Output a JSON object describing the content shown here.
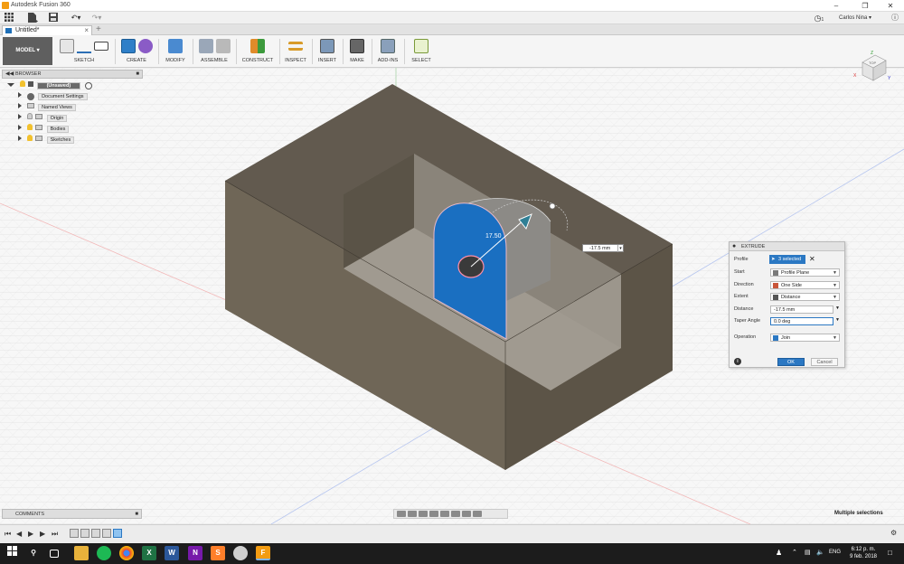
{
  "window": {
    "title": "Autodesk Fusion 360",
    "minimize_glyph": "–",
    "restore_glyph": "❐",
    "close_glyph": "✕"
  },
  "quick_access": {
    "user_name": "Carlos Nina",
    "jobs_count": "1"
  },
  "tabs": [
    {
      "label": "Untitled*"
    }
  ],
  "workspace": {
    "label": "MODEL"
  },
  "toolbar": {
    "groups": [
      {
        "label": "SKETCH"
      },
      {
        "label": "CREATE"
      },
      {
        "label": "MODIFY"
      },
      {
        "label": "ASSEMBLE"
      },
      {
        "label": "CONSTRUCT"
      },
      {
        "label": "INSPECT"
      },
      {
        "label": "INSERT"
      },
      {
        "label": "MAKE"
      },
      {
        "label": "ADD-INS"
      },
      {
        "label": "SELECT"
      }
    ],
    "active_group": "CREATE"
  },
  "browser": {
    "title": "BROWSER",
    "root": "(Unsaved)",
    "items": [
      {
        "label": "Document Settings"
      },
      {
        "label": "Named Views"
      },
      {
        "label": "Origin"
      },
      {
        "label": "Bodies"
      },
      {
        "label": "Sketches"
      }
    ]
  },
  "viewport": {
    "manipulator_label": "17.50",
    "distance_input": "-17.5 mm",
    "viewcube_face": "TOP",
    "viewcube_axes": [
      "X",
      "Y",
      "Z"
    ]
  },
  "extrude_dialog": {
    "title": "EXTRUDE",
    "rows": [
      {
        "label": "Profile",
        "value": "3 selected"
      },
      {
        "label": "Start",
        "value": "Profile Plane"
      },
      {
        "label": "Direction",
        "value": "One Side"
      },
      {
        "label": "Extent",
        "value": "Distance"
      },
      {
        "label": "Distance",
        "value": "-17.5 mm"
      },
      {
        "label": "Taper Angle",
        "value": "0.0 deg"
      },
      {
        "label": "Operation",
        "value": "Join"
      }
    ],
    "ok_label": "OK",
    "cancel_label": "Cancel"
  },
  "comments": {
    "title": "COMMENTS"
  },
  "status": {
    "text": "Multiple selections"
  },
  "taskbar": {
    "language": "ENG",
    "time": "6:12 p. m.",
    "date": "9 feb. 2018",
    "apps": [
      "Windows",
      "Search",
      "Task View",
      "File Explorer",
      "Spotify",
      "Chrome",
      "Excel",
      "Word",
      "OneNote",
      "Sublime Text",
      "App",
      "Fusion 360"
    ]
  },
  "colors": {
    "accent": "#2b78c3",
    "body": "#6e6557",
    "profile_face": "#1a6fc1"
  }
}
